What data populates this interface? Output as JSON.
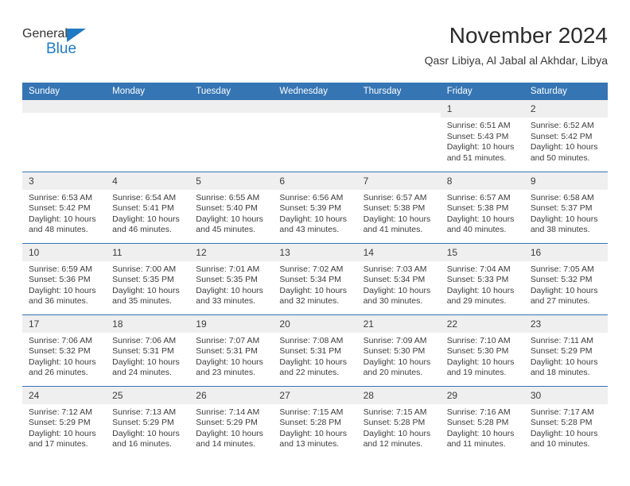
{
  "brand": {
    "name_part1": "General",
    "name_part2": "Blue",
    "triangle_icon": "triangle-icon",
    "accent_color": "#1e7bc4"
  },
  "header": {
    "title": "November 2024",
    "subtitle": "Qasr Libiya, Al Jabal al Akhdar, Libya"
  },
  "theme": {
    "header_blue": "#3575b4",
    "daynum_gray": "#efefef",
    "text_color": "#3c3c3c"
  },
  "calendar": {
    "weekday_headers": [
      "Sunday",
      "Monday",
      "Tuesday",
      "Wednesday",
      "Thursday",
      "Friday",
      "Saturday"
    ],
    "weeks": [
      [
        {
          "day": "",
          "empty": true
        },
        {
          "day": "",
          "empty": true
        },
        {
          "day": "",
          "empty": true
        },
        {
          "day": "",
          "empty": true
        },
        {
          "day": "",
          "empty": true
        },
        {
          "day": "1",
          "sunrise": "Sunrise: 6:51 AM",
          "sunset": "Sunset: 5:43 PM",
          "daylight_line1": "Daylight: 10 hours",
          "daylight_line2": "and 51 minutes."
        },
        {
          "day": "2",
          "sunrise": "Sunrise: 6:52 AM",
          "sunset": "Sunset: 5:42 PM",
          "daylight_line1": "Daylight: 10 hours",
          "daylight_line2": "and 50 minutes."
        }
      ],
      [
        {
          "day": "3",
          "sunrise": "Sunrise: 6:53 AM",
          "sunset": "Sunset: 5:42 PM",
          "daylight_line1": "Daylight: 10 hours",
          "daylight_line2": "and 48 minutes."
        },
        {
          "day": "4",
          "sunrise": "Sunrise: 6:54 AM",
          "sunset": "Sunset: 5:41 PM",
          "daylight_line1": "Daylight: 10 hours",
          "daylight_line2": "and 46 minutes."
        },
        {
          "day": "5",
          "sunrise": "Sunrise: 6:55 AM",
          "sunset": "Sunset: 5:40 PM",
          "daylight_line1": "Daylight: 10 hours",
          "daylight_line2": "and 45 minutes."
        },
        {
          "day": "6",
          "sunrise": "Sunrise: 6:56 AM",
          "sunset": "Sunset: 5:39 PM",
          "daylight_line1": "Daylight: 10 hours",
          "daylight_line2": "and 43 minutes."
        },
        {
          "day": "7",
          "sunrise": "Sunrise: 6:57 AM",
          "sunset": "Sunset: 5:38 PM",
          "daylight_line1": "Daylight: 10 hours",
          "daylight_line2": "and 41 minutes."
        },
        {
          "day": "8",
          "sunrise": "Sunrise: 6:57 AM",
          "sunset": "Sunset: 5:38 PM",
          "daylight_line1": "Daylight: 10 hours",
          "daylight_line2": "and 40 minutes."
        },
        {
          "day": "9",
          "sunrise": "Sunrise: 6:58 AM",
          "sunset": "Sunset: 5:37 PM",
          "daylight_line1": "Daylight: 10 hours",
          "daylight_line2": "and 38 minutes."
        }
      ],
      [
        {
          "day": "10",
          "sunrise": "Sunrise: 6:59 AM",
          "sunset": "Sunset: 5:36 PM",
          "daylight_line1": "Daylight: 10 hours",
          "daylight_line2": "and 36 minutes."
        },
        {
          "day": "11",
          "sunrise": "Sunrise: 7:00 AM",
          "sunset": "Sunset: 5:35 PM",
          "daylight_line1": "Daylight: 10 hours",
          "daylight_line2": "and 35 minutes."
        },
        {
          "day": "12",
          "sunrise": "Sunrise: 7:01 AM",
          "sunset": "Sunset: 5:35 PM",
          "daylight_line1": "Daylight: 10 hours",
          "daylight_line2": "and 33 minutes."
        },
        {
          "day": "13",
          "sunrise": "Sunrise: 7:02 AM",
          "sunset": "Sunset: 5:34 PM",
          "daylight_line1": "Daylight: 10 hours",
          "daylight_line2": "and 32 minutes."
        },
        {
          "day": "14",
          "sunrise": "Sunrise: 7:03 AM",
          "sunset": "Sunset: 5:34 PM",
          "daylight_line1": "Daylight: 10 hours",
          "daylight_line2": "and 30 minutes."
        },
        {
          "day": "15",
          "sunrise": "Sunrise: 7:04 AM",
          "sunset": "Sunset: 5:33 PM",
          "daylight_line1": "Daylight: 10 hours",
          "daylight_line2": "and 29 minutes."
        },
        {
          "day": "16",
          "sunrise": "Sunrise: 7:05 AM",
          "sunset": "Sunset: 5:32 PM",
          "daylight_line1": "Daylight: 10 hours",
          "daylight_line2": "and 27 minutes."
        }
      ],
      [
        {
          "day": "17",
          "sunrise": "Sunrise: 7:06 AM",
          "sunset": "Sunset: 5:32 PM",
          "daylight_line1": "Daylight: 10 hours",
          "daylight_line2": "and 26 minutes."
        },
        {
          "day": "18",
          "sunrise": "Sunrise: 7:06 AM",
          "sunset": "Sunset: 5:31 PM",
          "daylight_line1": "Daylight: 10 hours",
          "daylight_line2": "and 24 minutes."
        },
        {
          "day": "19",
          "sunrise": "Sunrise: 7:07 AM",
          "sunset": "Sunset: 5:31 PM",
          "daylight_line1": "Daylight: 10 hours",
          "daylight_line2": "and 23 minutes."
        },
        {
          "day": "20",
          "sunrise": "Sunrise: 7:08 AM",
          "sunset": "Sunset: 5:31 PM",
          "daylight_line1": "Daylight: 10 hours",
          "daylight_line2": "and 22 minutes."
        },
        {
          "day": "21",
          "sunrise": "Sunrise: 7:09 AM",
          "sunset": "Sunset: 5:30 PM",
          "daylight_line1": "Daylight: 10 hours",
          "daylight_line2": "and 20 minutes."
        },
        {
          "day": "22",
          "sunrise": "Sunrise: 7:10 AM",
          "sunset": "Sunset: 5:30 PM",
          "daylight_line1": "Daylight: 10 hours",
          "daylight_line2": "and 19 minutes."
        },
        {
          "day": "23",
          "sunrise": "Sunrise: 7:11 AM",
          "sunset": "Sunset: 5:29 PM",
          "daylight_line1": "Daylight: 10 hours",
          "daylight_line2": "and 18 minutes."
        }
      ],
      [
        {
          "day": "24",
          "sunrise": "Sunrise: 7:12 AM",
          "sunset": "Sunset: 5:29 PM",
          "daylight_line1": "Daylight: 10 hours",
          "daylight_line2": "and 17 minutes."
        },
        {
          "day": "25",
          "sunrise": "Sunrise: 7:13 AM",
          "sunset": "Sunset: 5:29 PM",
          "daylight_line1": "Daylight: 10 hours",
          "daylight_line2": "and 16 minutes."
        },
        {
          "day": "26",
          "sunrise": "Sunrise: 7:14 AM",
          "sunset": "Sunset: 5:29 PM",
          "daylight_line1": "Daylight: 10 hours",
          "daylight_line2": "and 14 minutes."
        },
        {
          "day": "27",
          "sunrise": "Sunrise: 7:15 AM",
          "sunset": "Sunset: 5:28 PM",
          "daylight_line1": "Daylight: 10 hours",
          "daylight_line2": "and 13 minutes."
        },
        {
          "day": "28",
          "sunrise": "Sunrise: 7:15 AM",
          "sunset": "Sunset: 5:28 PM",
          "daylight_line1": "Daylight: 10 hours",
          "daylight_line2": "and 12 minutes."
        },
        {
          "day": "29",
          "sunrise": "Sunrise: 7:16 AM",
          "sunset": "Sunset: 5:28 PM",
          "daylight_line1": "Daylight: 10 hours",
          "daylight_line2": "and 11 minutes."
        },
        {
          "day": "30",
          "sunrise": "Sunrise: 7:17 AM",
          "sunset": "Sunset: 5:28 PM",
          "daylight_line1": "Daylight: 10 hours",
          "daylight_line2": "and 10 minutes."
        }
      ]
    ]
  }
}
